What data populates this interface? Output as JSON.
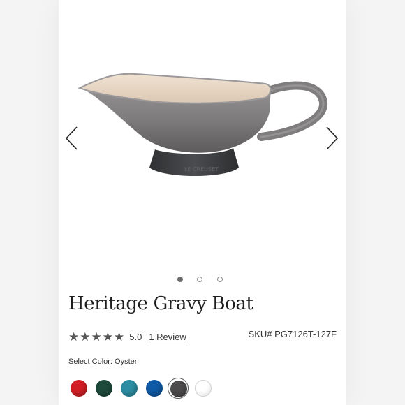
{
  "product": {
    "title": "Heritage Gravy Boat",
    "rating_value": "5.0",
    "rating": 5,
    "rating_max": 5,
    "review_link": "1 Review",
    "sku": "SKU# PG7126T-127F",
    "select_color_label": "Select Color: Oyster"
  },
  "gallery": {
    "current_index": 1,
    "image_count": 3,
    "accent_glaze": "#8e8b8c",
    "interior_color": "#e9d8c6",
    "base_color": "#3f4144"
  },
  "swatches": [
    {
      "color": "#d31f26",
      "name": "red"
    },
    {
      "color": "#1e4a3c",
      "name": "green"
    },
    {
      "color": "#2d8ea3",
      "name": "teal"
    },
    {
      "color": "#0f5aa6",
      "name": "blue"
    },
    {
      "color": "#4d4b4c",
      "name": "oyster",
      "selected": true
    },
    {
      "color": "#ffffff",
      "name": "white"
    }
  ],
  "icons": {
    "prev": "chevron-left-icon",
    "next": "chevron-right-icon",
    "star": "star-icon"
  }
}
